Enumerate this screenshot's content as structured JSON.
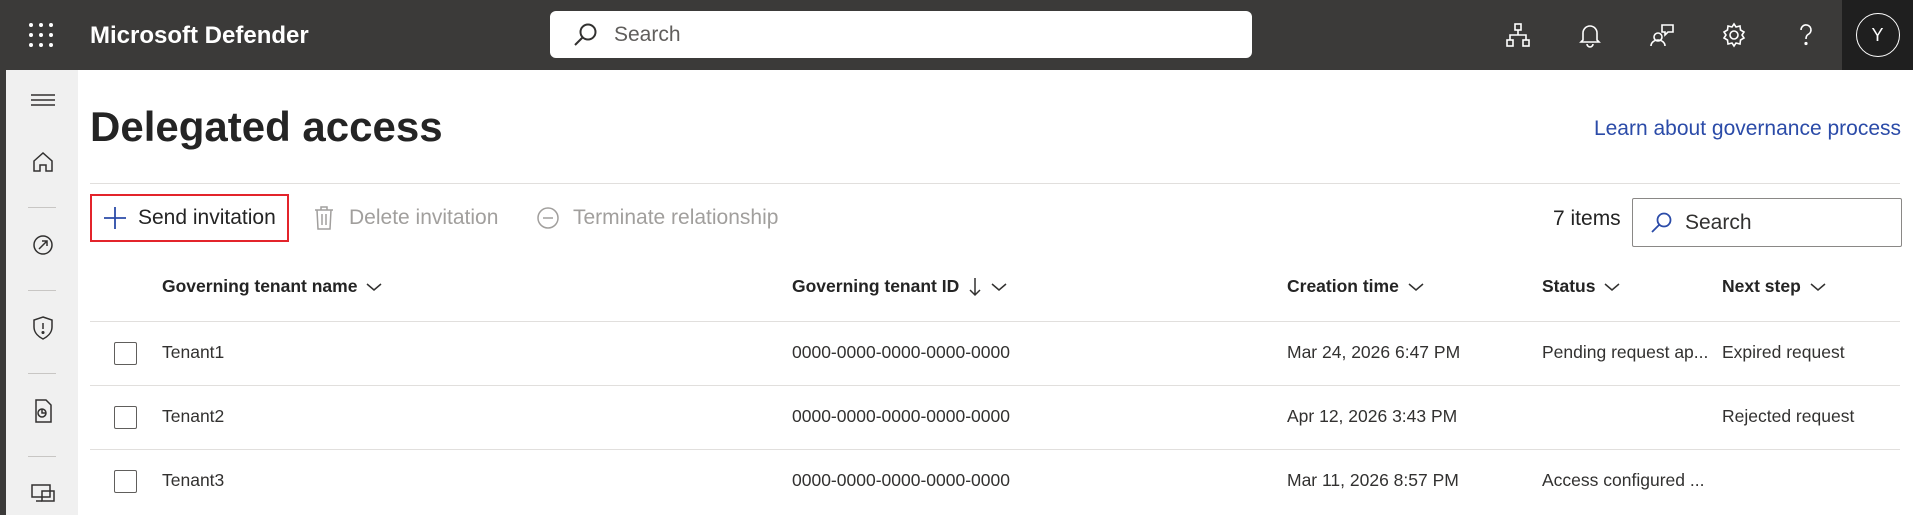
{
  "topbar": {
    "app_title": "Microsoft Defender",
    "search_placeholder": "Search",
    "icons": [
      "waffle-icon",
      "org-chart-icon",
      "bell-icon",
      "community-icon",
      "gear-icon",
      "help-icon"
    ],
    "avatar_initial": "Y",
    "background": "#3b3a39"
  },
  "sidebar": {
    "items": [
      "menu-icon",
      "home-icon",
      "incidents-icon",
      "shield-icon",
      "reports-icon",
      "devices-icon"
    ]
  },
  "page": {
    "title": "Delegated access",
    "learn_link": "Learn about governance process"
  },
  "toolbar": {
    "send_invitation": "Send invitation",
    "delete_invitation": "Delete invitation",
    "terminate_relationship": "Terminate relationship",
    "items_count": "7 items",
    "search_placeholder": "Search"
  },
  "table": {
    "columns": {
      "name": "Governing tenant name",
      "id": "Governing tenant ID",
      "created": "Creation time",
      "status": "Status",
      "next": "Next step"
    },
    "rows": [
      {
        "name": "Tenant1",
        "id": "0000-0000-0000-0000-0000",
        "created": "Mar 24, 2026 6:47 PM",
        "status": "Pending request ap...",
        "next": "Expired request"
      },
      {
        "name": "Tenant2",
        "id": "0000-0000-0000-0000-0000",
        "created": "Apr 12, 2026 3:43 PM",
        "status": "",
        "next": "Rejected request"
      },
      {
        "name": "Tenant3",
        "id": "0000-0000-0000-0000-0000",
        "created": "Mar 11, 2026 8:57 PM",
        "status": "Access configured ...",
        "next": ""
      }
    ]
  },
  "colors": {
    "accent": "#2b4ba8",
    "highlight_border": "#e3242b"
  }
}
